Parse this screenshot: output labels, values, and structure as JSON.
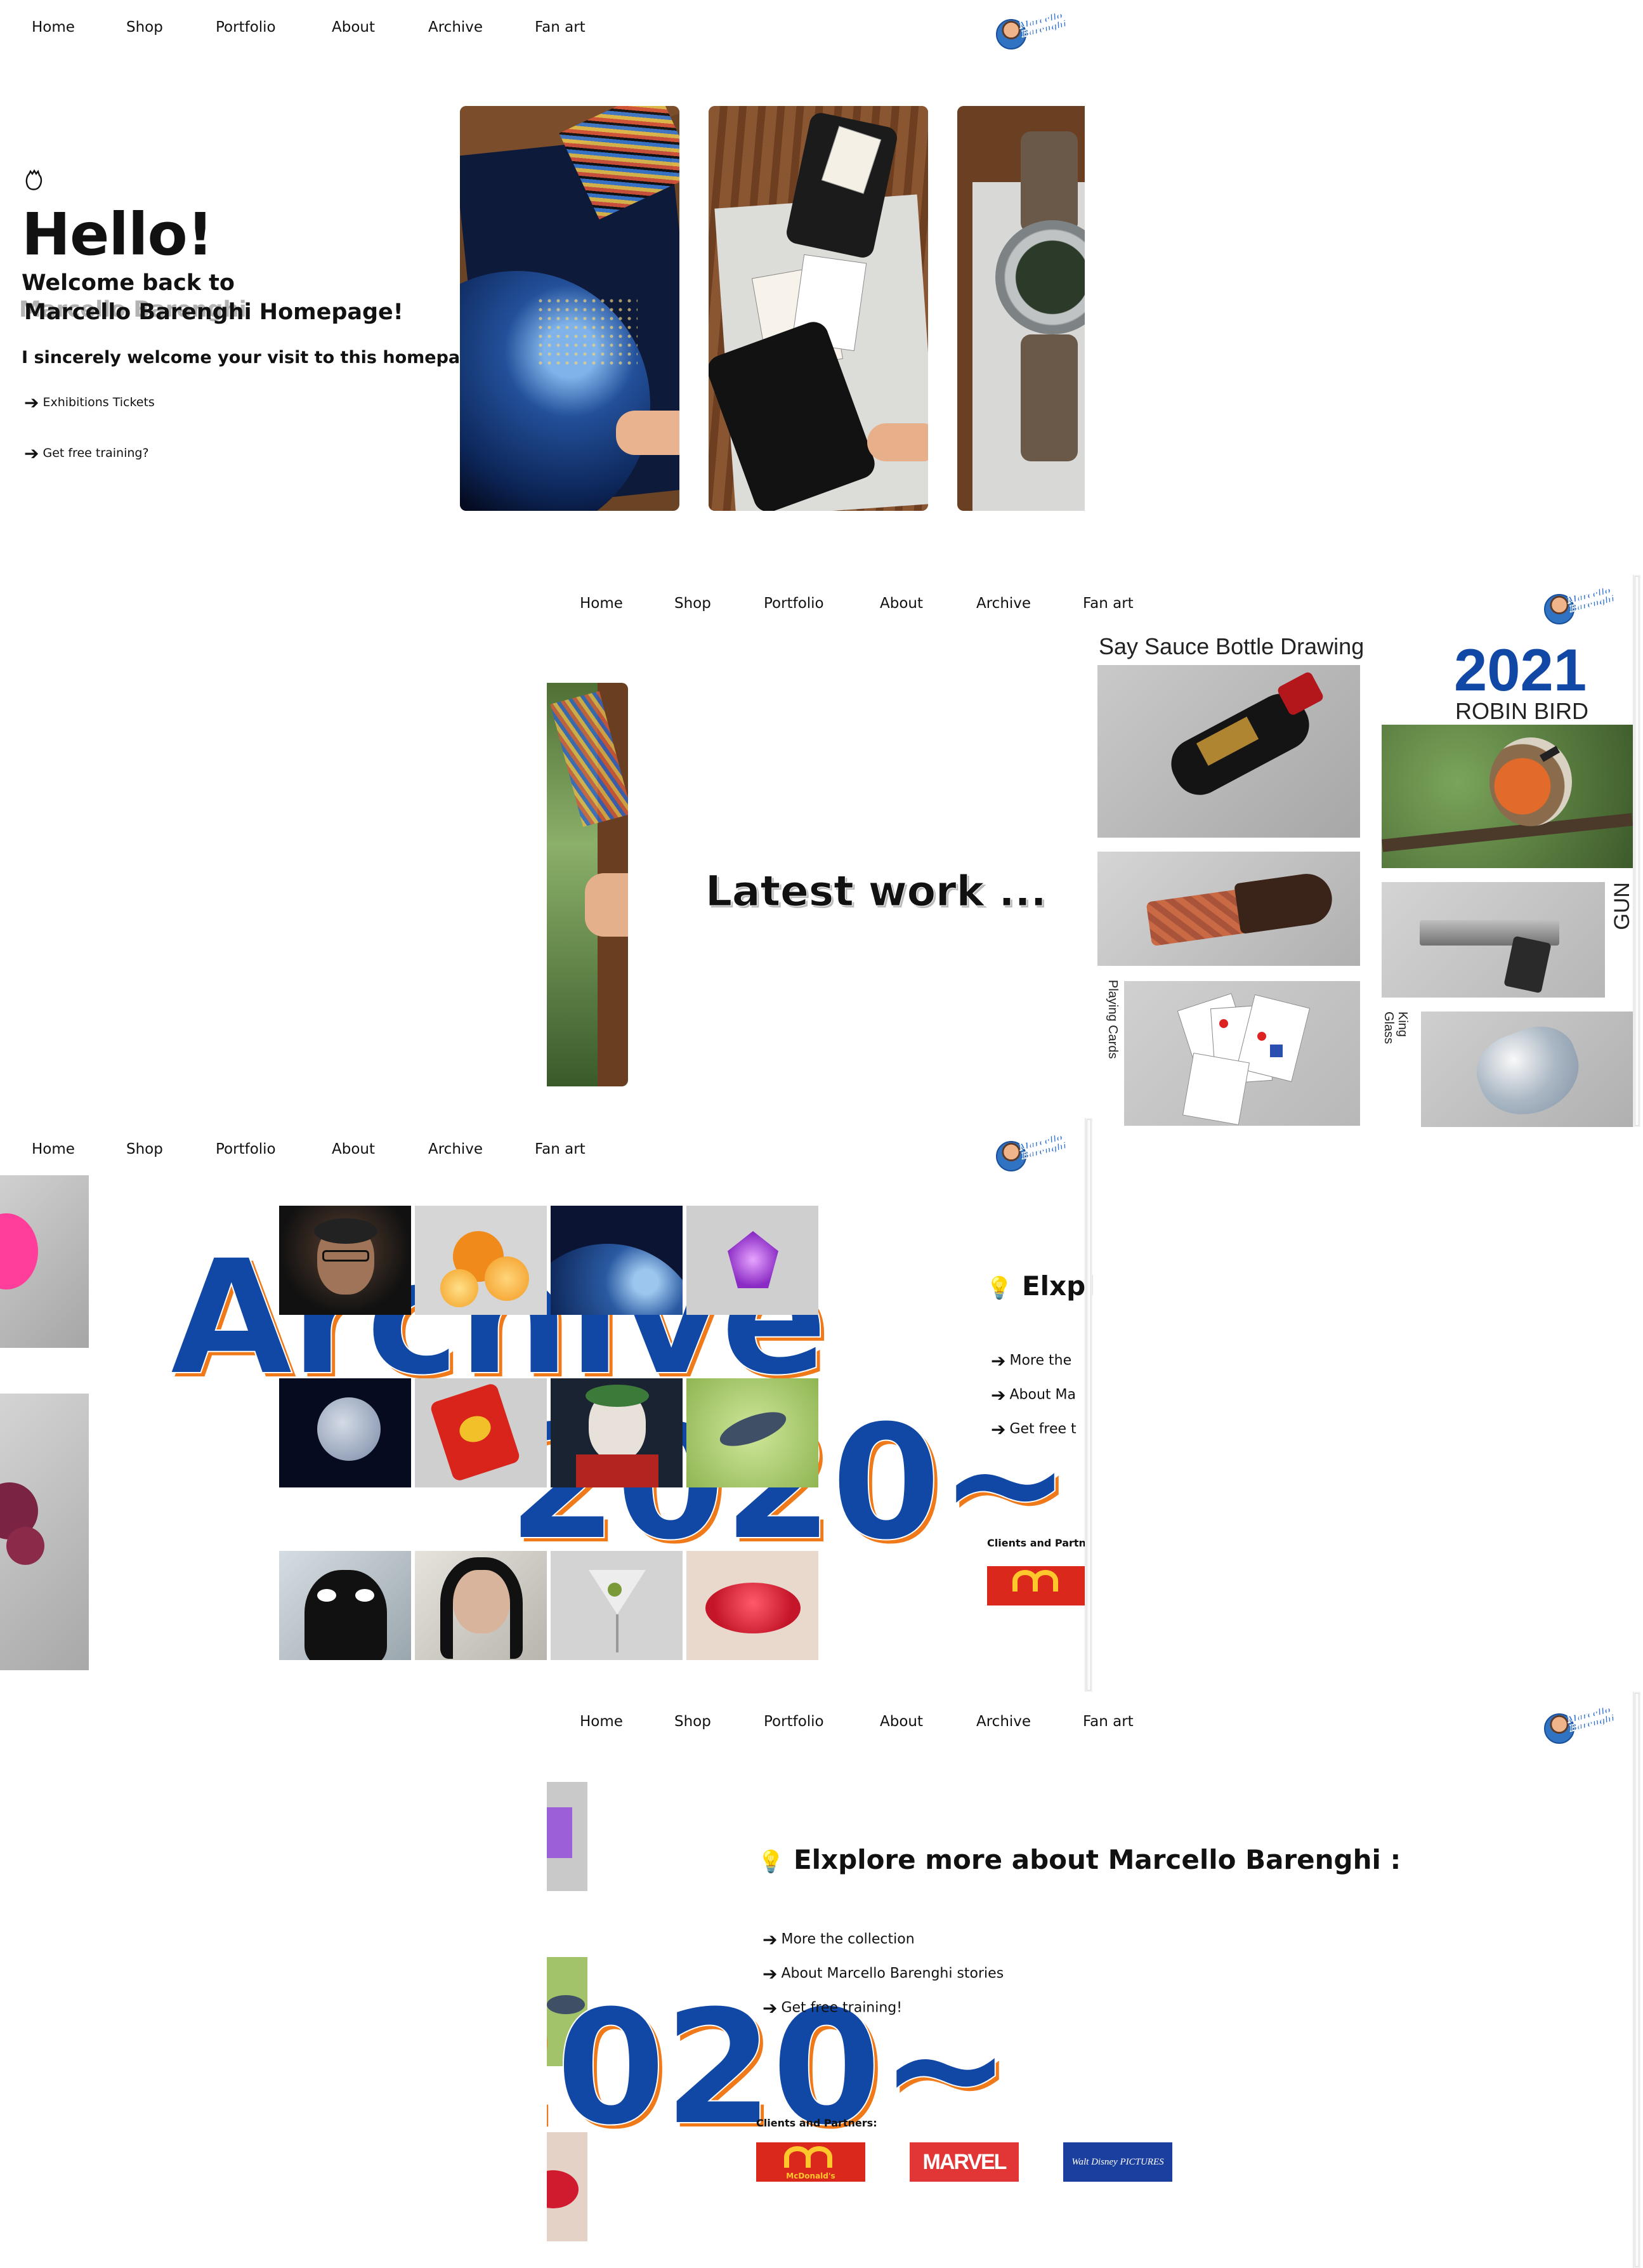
{
  "nav": {
    "items": [
      "Home",
      "Shop",
      "Portfolio",
      "About",
      "Archive",
      "Fan art"
    ],
    "logo_text": "Marcello Barenghi"
  },
  "hero": {
    "wave_icon": "waving-hand-icon",
    "title": "Hello!",
    "subtitle_line1": "Welcome back to",
    "subtitle_line2": "Marcello Barenghi Homepage!",
    "subtitle_ghost": "Marcello Barenghi",
    "welcome": "I sincerely welcome your visit to this homepage.",
    "link1": "Exhibitions Tickets",
    "link2": "Get free training?",
    "images": [
      "earth-at-night-drawing",
      "playing-cards-drawing",
      "wristwatch-drawing"
    ]
  },
  "latest": {
    "heading": "Latest work ...",
    "works": {
      "soy": "Say Sauce Bottle Drawing",
      "year": "2021",
      "robin": "ROBIN BIRD",
      "gun": "GUN",
      "cards": "Playing Cards",
      "king": "King",
      "glass": "Glass"
    }
  },
  "archive": {
    "word": "Archive",
    "years": "2020~",
    "grid": [
      "la-casa-de-papel-portrait",
      "oranges",
      "earth-at-night",
      "amethyst",
      "moon",
      "chips-bag",
      "joker",
      "koi-fish",
      "venom",
      "eminem",
      "martini",
      "red-lips"
    ]
  },
  "explore": {
    "bulb_icon": "lightbulb-icon",
    "heading": "Elxplore more about Marcello Barenghi :",
    "heading_short": "Elxpl",
    "links": [
      "More the collection",
      "About Marcello Barenghi stories",
      "Get free training!"
    ],
    "links_cut": [
      "More the",
      "About Ma",
      "Get free t"
    ],
    "partners_label": "Clients and Partners:",
    "partners_label_cut": "Clients and Partne",
    "partners": [
      "McDonald's",
      "MARVEL",
      "Walt Disney PICTURES"
    ]
  },
  "colors": {
    "brand_blue": "#1148a6",
    "accent_orange": "#f07a1a",
    "mcd_red": "#da291c",
    "mcd_yellow": "#ffc72c",
    "marvel_red": "#e23636",
    "disney_blue": "#1b3f9e"
  }
}
